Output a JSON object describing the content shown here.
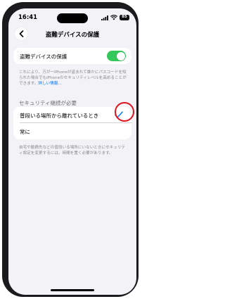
{
  "status_bar": {
    "time": "16:41",
    "battery": "85"
  },
  "nav": {
    "title": "盗難デバイスの保護"
  },
  "protection": {
    "label": "盗難デバイスの保護",
    "enabled": true,
    "footnote_text": "これにより、万が一iPhoneが盗まれて誰かにパスコードを知られた場合でもiPhoneのセキュリティレベルを高めることができます。",
    "footnote_link": "詳しい情報..."
  },
  "security_delay": {
    "header": "セキュリティ継続が必要",
    "options": [
      {
        "label": "普段いる場所から離れているとき",
        "selected": true
      },
      {
        "label": "常に",
        "selected": false
      }
    ],
    "footnote": "自宅や勤務先などの普段いる場所にいないときにセキュリティ設定を変更するには、時間を置く必要があります。"
  },
  "colors": {
    "accent": "#007aff",
    "toggle_on": "#34c759",
    "highlight": "#e0141e"
  }
}
